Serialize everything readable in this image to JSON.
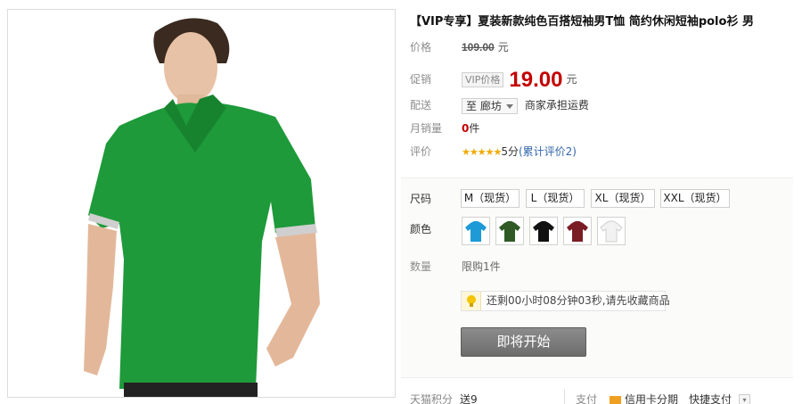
{
  "product": {
    "title": "【VIP专享】夏装新款纯色百搭短袖男T恤 简约休闲短袖polo衫 男"
  },
  "price": {
    "label": "价格",
    "original": "109.00",
    "unit": "元"
  },
  "promo": {
    "label": "促销",
    "tag": "VIP价格",
    "price": "19.00",
    "unit": "元"
  },
  "delivery": {
    "label": "配送",
    "location": "至 廊坊",
    "note": "商家承担运费"
  },
  "monthly_sales": {
    "label": "月销量",
    "count": "0",
    "unit": "件"
  },
  "rating": {
    "label": "评价",
    "stars": "★★★★★",
    "score": "5分",
    "link": "(累计评价2)"
  },
  "sku": {
    "size_label": "尺码",
    "sizes": [
      "M（现货）",
      "L（现货）",
      "XL（现货）",
      "XXL（现货）"
    ],
    "color_label": "颜色",
    "colors": [
      "#1e9ad6",
      "#2f5a26",
      "#111111",
      "#7a1c24",
      "#f2f2f2"
    ],
    "qty_label": "数量",
    "qty_limit": "限购1件"
  },
  "timer": {
    "text": "还剩00小时08分钟03秒,请先收藏商品",
    "icon": "lightbulb-icon"
  },
  "action": {
    "button": "即将开始"
  },
  "bottom": {
    "points_label": "天猫积分",
    "points_value": "送9",
    "pay_label": "支付",
    "credit": "信用卡分期",
    "quick": "快捷支付"
  }
}
